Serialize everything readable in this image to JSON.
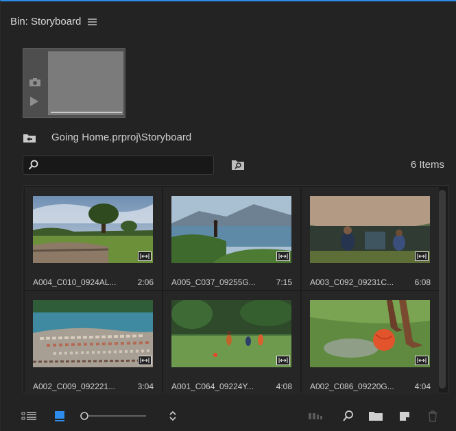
{
  "panel": {
    "title": "Bin: Storyboard"
  },
  "path": {
    "text": "Going Home.prproj\\Storyboard"
  },
  "search": {
    "value": "",
    "placeholder": ""
  },
  "items_count": "6 Items",
  "clips": [
    {
      "name": "A004_C010_0924AL...",
      "duration": "2:06",
      "scene": "tree-field"
    },
    {
      "name": "A005_C037_09255G...",
      "duration": "7:15",
      "scene": "lake-hills"
    },
    {
      "name": "A003_C092_09231C...",
      "duration": "6:08",
      "scene": "hut-children"
    },
    {
      "name": "A002_C009_092221...",
      "duration": "3:04",
      "scene": "island-town"
    },
    {
      "name": "A001_C064_09224Y...",
      "duration": "4:08",
      "scene": "football-field"
    },
    {
      "name": "A002_C086_09220G...",
      "duration": "4:04",
      "scene": "ball-kick"
    }
  ],
  "colors": {
    "accent": "#2d8ceb",
    "panel": "#232323",
    "grid": "#1c1c1c"
  },
  "icons": {
    "list_view": "list-view-icon",
    "icon_view": "icon-view-icon",
    "zoom_slider": "zoom-slider",
    "sort": "sort-icon",
    "automate": "automate-to-sequence-icon",
    "find": "find-icon",
    "new_bin": "new-bin-icon",
    "new_item": "new-item-icon",
    "clear": "trash-icon"
  },
  "zoom": {
    "level": 0.0
  }
}
